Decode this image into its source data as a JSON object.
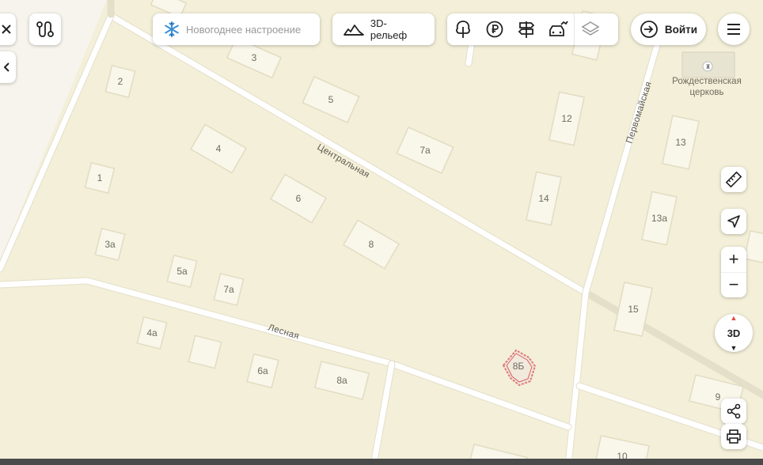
{
  "toolbar": {
    "close_icon": "close-icon",
    "route_icon": "route-icon",
    "collapse_icon": "chevron-left-icon",
    "new_year_label": "Новогоднее настроение",
    "relief_label": "3D-рельеф",
    "layers": [
      "park-icon",
      "ruble-icon",
      "signpost-icon",
      "car-service-icon",
      "layers-icon"
    ],
    "login_label": "Войти",
    "menu_icon": "menu-icon"
  },
  "map": {
    "streets": {
      "central": "Центральная",
      "pervomayskaya": "Первомайская",
      "lesnaya": "Лесная"
    },
    "poi": {
      "line1": "Рождественская",
      "line2": "церковь"
    },
    "houses": {
      "h3": "3",
      "h2": "2",
      "h5": "5",
      "h4": "4",
      "h7a": "7а",
      "h12": "12",
      "h13": "13",
      "h1": "1",
      "h6": "6",
      "h14": "14",
      "h13a": "13а",
      "h8": "8",
      "h3a": "3а",
      "h5a": "5а",
      "h7a2": "7а",
      "h15": "15",
      "h4a": "4а",
      "h6a": "6а",
      "h8a": "8а",
      "h8b": "8Б",
      "h9": "9",
      "h10": "10"
    }
  },
  "controls": {
    "ruler_icon": "ruler-icon",
    "locate_icon": "location-arrow-icon",
    "zoom_in": "+",
    "zoom_out": "−",
    "view_3d": "3D",
    "share_icon": "share-icon",
    "print_icon": "print-icon"
  },
  "colors": {
    "map_background": "#f3efd8",
    "road": "#ffffff",
    "building": "#f9f6ea",
    "highlight": "#e06060"
  }
}
